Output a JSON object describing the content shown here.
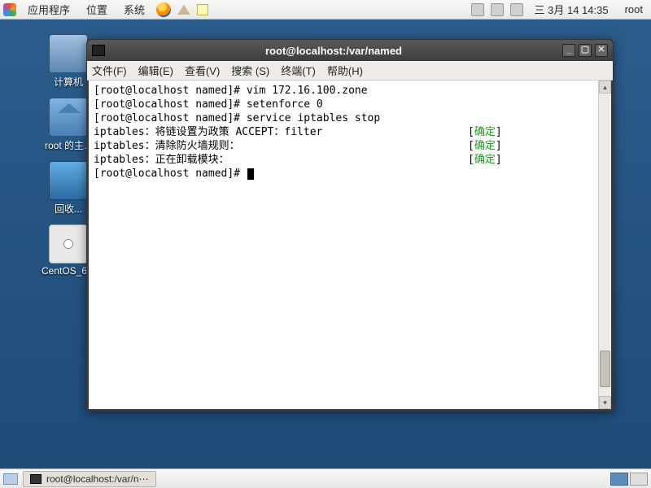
{
  "top_panel": {
    "apps": "应用程序",
    "places": "位置",
    "system": "系统",
    "datetime": "三  3月 14 14:35",
    "user": "root"
  },
  "desktop_icons": {
    "computer": "计算机",
    "home": "root 的主...",
    "trash": "回收...",
    "cd": "CentOS_6..."
  },
  "window": {
    "title": "root@localhost:/var/named",
    "menu": {
      "file": "文件(F)",
      "edit": "编辑(E)",
      "view": "查看(V)",
      "search": "搜索 (S)",
      "terminal": "终端(T)",
      "help": "帮助(H)"
    },
    "lines": {
      "l1_prompt": "[root@localhost named]#",
      "l1_cmd": " vim 172.16.100.zone",
      "l2_prompt": "[root@localhost named]#",
      "l2_cmd": " setenforce 0",
      "l3_prompt": "[root@localhost named]#",
      "l3_cmd": " service iptables stop",
      "l4_text": "iptables：将链设置为政策 ACCEPT：filter",
      "l5_text": "iptables：清除防火墙规则：",
      "l6_text": "iptables：正在卸载模块：",
      "ok_open": "[",
      "ok_text": "确定",
      "ok_close": "]",
      "l7_prompt": "[root@localhost named]# "
    }
  },
  "bottom_panel": {
    "task": "root@localhost:/var/n⋯"
  }
}
